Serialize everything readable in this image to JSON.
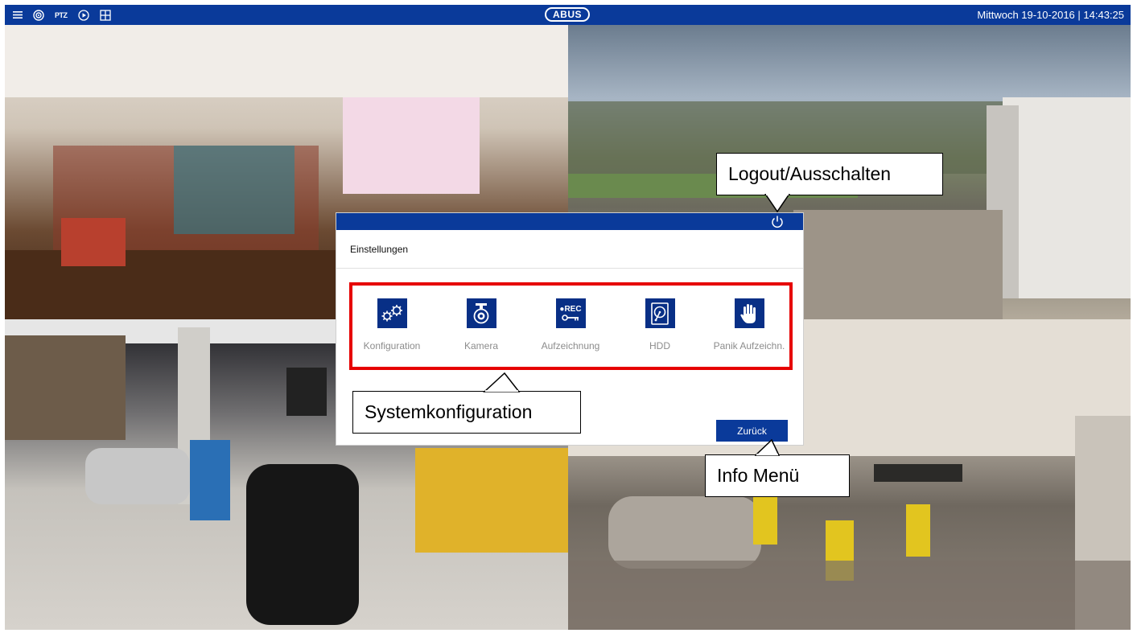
{
  "topbar": {
    "icons": [
      "menu-icon",
      "camera-icon",
      "ptz-icon",
      "playback-icon",
      "layout-grid-icon"
    ],
    "ptz_text": "PTZ",
    "logo": "ABUS",
    "datetime": "Mittwoch 19-10-2016 |  14:43:25",
    "background": "#0a3a9a"
  },
  "dialog": {
    "title": "Einstellungen",
    "items": [
      {
        "label": "Konfiguration",
        "icon": "gears-icon"
      },
      {
        "label": "Kamera",
        "icon": "camera-icon"
      },
      {
        "label": "Aufzeichnung",
        "icon": "record-icon",
        "icon_text": "●REC"
      },
      {
        "label": "HDD",
        "icon": "hdd-icon"
      },
      {
        "label": "Panik Aufzeichn.",
        "icon": "hand-icon"
      }
    ],
    "back_label": "Zurück",
    "accent": "#082f86"
  },
  "callouts": {
    "logout": "Logout/Ausschalten",
    "system": "Systemkonfiguration",
    "info": "Info Menü",
    "highlight_color": "#e60000"
  }
}
